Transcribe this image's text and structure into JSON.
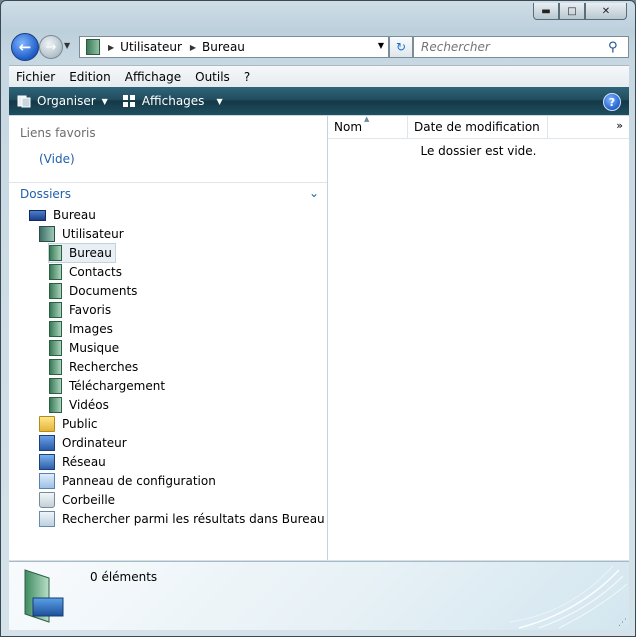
{
  "window": {
    "controls": [
      "minimize",
      "maximize",
      "close"
    ]
  },
  "address": {
    "crumbs": [
      "Utilisateur",
      "Bureau"
    ]
  },
  "search": {
    "placeholder": "Rechercher"
  },
  "menu": {
    "items": [
      "Fichier",
      "Edition",
      "Affichage",
      "Outils",
      "?"
    ]
  },
  "commands": {
    "organise": "Organiser",
    "views": "Affichages"
  },
  "favorites": {
    "title": "Liens favoris",
    "empty": "(Vide)"
  },
  "folders": {
    "title": "Dossiers",
    "tree": [
      {
        "label": "Bureau",
        "icon": "desktop-icon"
      },
      {
        "label": "Utilisateur",
        "icon": "user-folder-icon"
      },
      {
        "label": "Bureau",
        "icon": "folder-icon",
        "selected": true
      },
      {
        "label": "Contacts",
        "icon": "contacts-folder-icon"
      },
      {
        "label": "Documents",
        "icon": "documents-folder-icon"
      },
      {
        "label": "Favoris",
        "icon": "favorites-folder-icon"
      },
      {
        "label": "Images",
        "icon": "images-folder-icon"
      },
      {
        "label": "Musique",
        "icon": "music-folder-icon"
      },
      {
        "label": "Recherches",
        "icon": "searches-folder-icon"
      },
      {
        "label": "Téléchargement",
        "icon": "downloads-folder-icon"
      },
      {
        "label": "Vidéos",
        "icon": "videos-folder-icon"
      },
      {
        "label": "Public",
        "icon": "public-folder-icon"
      },
      {
        "label": "Ordinateur",
        "icon": "computer-icon"
      },
      {
        "label": "Réseau",
        "icon": "network-icon"
      },
      {
        "label": "Panneau de configuration",
        "icon": "control-panel-icon"
      },
      {
        "label": "Corbeille",
        "icon": "recycle-bin-icon"
      },
      {
        "label": "Rechercher parmi les résultats dans Bureau",
        "icon": "search-results-icon"
      }
    ]
  },
  "filelist": {
    "columns": [
      "Nom",
      "Date de modification"
    ],
    "empty_message": "Le dossier est vide."
  },
  "details": {
    "count": "0 éléments"
  }
}
